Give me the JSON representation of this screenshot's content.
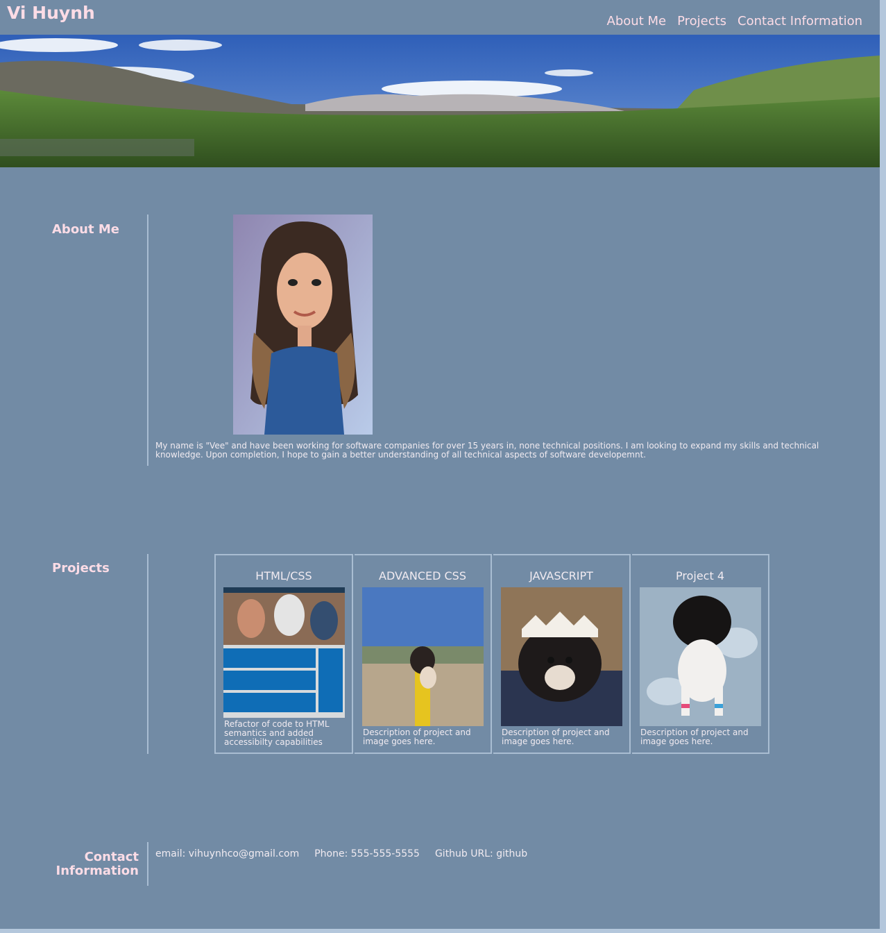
{
  "header": {
    "title": "Vi Huynh",
    "nav": [
      "About Me",
      "Projects",
      "Contact Information"
    ]
  },
  "about": {
    "heading": "About Me",
    "text": "My name is \"Vee\" and have been working for software companies for over 15 years in, none technical positions. I am looking to expand my skills and technical knowledge. Upon completion, I hope to gain a better understanding of all technical aspects of software developemnt."
  },
  "projects": {
    "heading": "Projects",
    "items": [
      {
        "title": "HTML/CSS",
        "desc": "Refactor of code to HTML semantics and added accessibilty capabilities"
      },
      {
        "title": "ADVANCED CSS",
        "desc": "Description of project and image goes here."
      },
      {
        "title": "JAVASCRIPT",
        "desc": "Description of project and image goes here."
      },
      {
        "title": "Project 4",
        "desc": "Description of project and image goes here."
      }
    ]
  },
  "contact": {
    "heading": "Contact Information",
    "email": "email: vihuynhco@gmail.com",
    "phone": "Phone: 555-555-5555",
    "github": "Github URL: github"
  }
}
